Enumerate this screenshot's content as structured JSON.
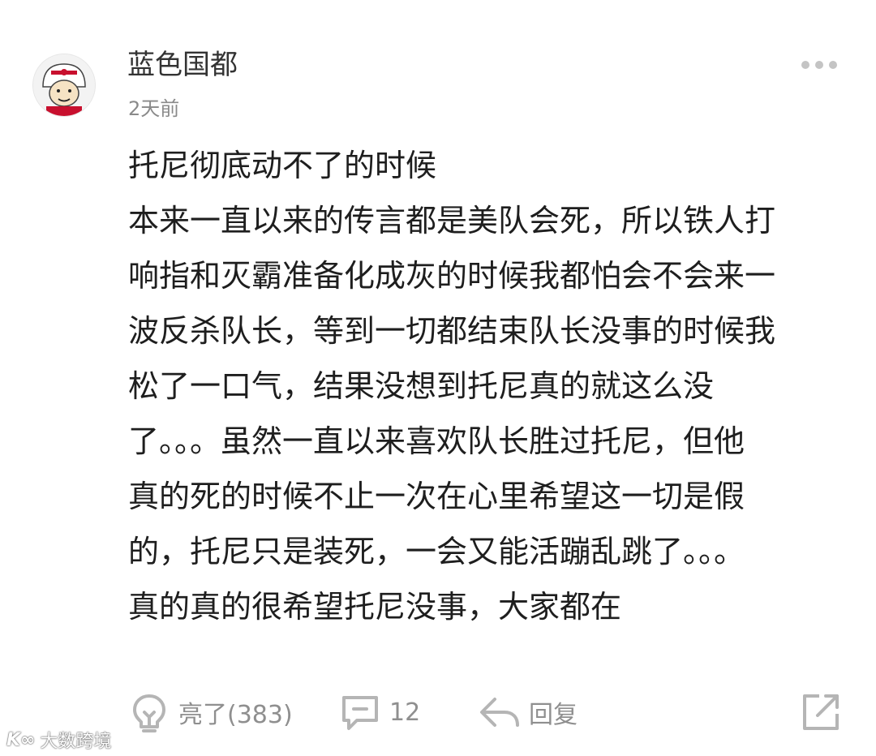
{
  "user": {
    "name": "蓝色国都",
    "time": "2天前",
    "avatar_icon": "rockets-helmet-meme-avatar"
  },
  "comment": {
    "lines": [
      "托尼彻底动不了的时候",
      "本来一直以来的传言都是美队会死，所以铁人打",
      "响指和灭霸准备化成灰的时候我都怕会不会来一",
      "波反杀队长，等到一切都结束队长没事的时候我",
      "松了一口气，结果没想到托尼真的就这么没",
      "了。。。虽然一直以来喜欢队长胜过托尼，但他",
      "真的死的时候不止一次在心里希望这一切是假",
      "的，托尼只是装死，一会又能活蹦乱跳了。。。",
      "真的真的很希望托尼没事，大家都在"
    ]
  },
  "actions": {
    "like": {
      "label": "亮了(383)",
      "icon": "lightbulb-icon"
    },
    "comment": {
      "label": "12",
      "icon": "comment-bubble-icon"
    },
    "reply": {
      "label": "回复",
      "icon": "reply-arrow-icon"
    },
    "share": {
      "icon": "share-icon"
    },
    "more_icon": "more-dots-icon"
  },
  "watermark": {
    "logo": "K∞",
    "text": "大数跨境"
  },
  "colors": {
    "text_primary": "#1e1e1e",
    "text_secondary": "#8a8a8a",
    "icon_gray": "#b5b5b5"
  }
}
